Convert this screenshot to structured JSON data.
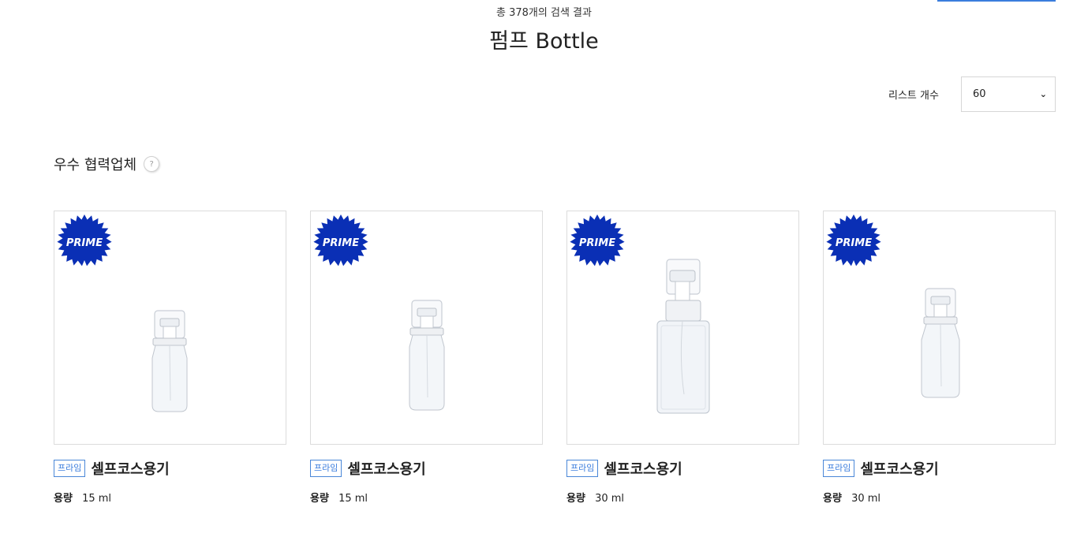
{
  "search": {
    "result_count_text": "총 378개의 검색 결과",
    "title": "펌프 Bottle"
  },
  "list_control": {
    "label": "리스트 개수",
    "selected": "60"
  },
  "section": {
    "title": "우수 협력업체",
    "help_symbol": "?"
  },
  "colors": {
    "accent": "#3b7ddd",
    "prime_badge": "#0a2fb5"
  },
  "products": [
    {
      "badge_text": "PRIME",
      "tier": "프라임",
      "name": "셀프코스용기",
      "capacity_label": "용량",
      "capacity_value": "15 ml"
    },
    {
      "badge_text": "PRIME",
      "tier": "프라임",
      "name": "셀프코스용기",
      "capacity_label": "용량",
      "capacity_value": "15 ml"
    },
    {
      "badge_text": "PRIME",
      "tier": "프라임",
      "name": "셀프코스용기",
      "capacity_label": "용량",
      "capacity_value": "30 ml"
    },
    {
      "badge_text": "PRIME",
      "tier": "프라임",
      "name": "셀프코스용기",
      "capacity_label": "용량",
      "capacity_value": "30 ml"
    }
  ]
}
